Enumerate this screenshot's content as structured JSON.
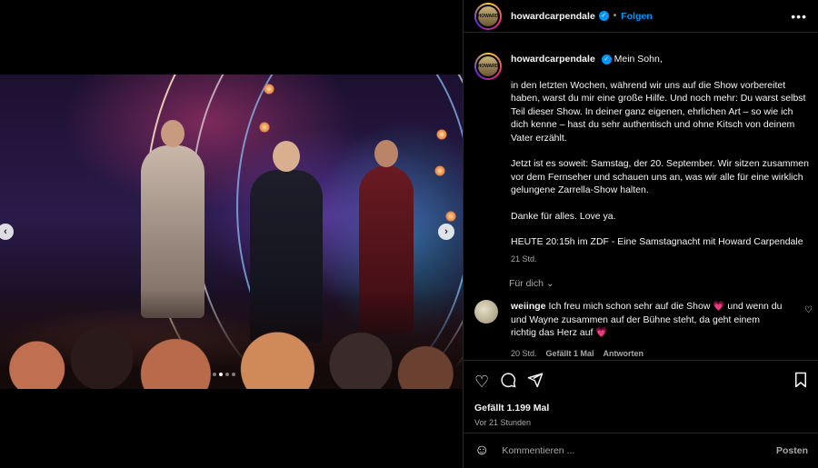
{
  "post": {
    "username": "howardcarpendale",
    "separator": "•",
    "follow_label": "Folgen",
    "more_icon": "more-horizontal-icon",
    "avatar_text": "HOWARD"
  },
  "media": {
    "prev_icon": "‹",
    "next_icon": "›",
    "slide_count": 4,
    "active_slide": 2
  },
  "caption": {
    "username": "howardcarpendale",
    "paragraphs": [
      "Mein Sohn,",
      "in den letzten Wochen, während wir uns auf die Show vorbereitet haben, warst du mir eine große Hilfe. Und noch mehr: Du warst selbst Teil dieser Show. In deiner ganz eigenen, ehrlichen Art – so wie ich dich kenne – hast du sehr authentisch und ohne Kitsch von deinem Vater erzählt.",
      "Jetzt ist es soweit: Samstag, der 20. September. Wir sitzen zusammen vor dem Fernseher und schauen uns an, was wir alle für eine wirklich gelungene Zarrella-Show halten.",
      "Danke für alles. Love ya.",
      "HEUTE 20:15h im ZDF - Eine Samstagnacht mit Howard Carpendale"
    ],
    "time": "21 Std."
  },
  "for_you": "Für dich",
  "comment": {
    "username": "weiinge",
    "text": "Ich freu mich schon sehr auf die Show 💗 und wenn du und Wayne zusammen auf der Bühne steht, da geht einem richtig das Herz auf 💗",
    "time": "20 Std.",
    "likes": "Gefällt 1 Mal",
    "reply": "Antworten"
  },
  "actions": {
    "likes": "Gefällt 1.199 Mal",
    "ago": "Vor 21 Stunden"
  },
  "add_comment": {
    "placeholder": "Kommentieren ...",
    "post_label": "Posten"
  },
  "colors": {
    "accent": "#0095f6",
    "background": "#000000",
    "secondary_text": "#a8a8a8"
  }
}
